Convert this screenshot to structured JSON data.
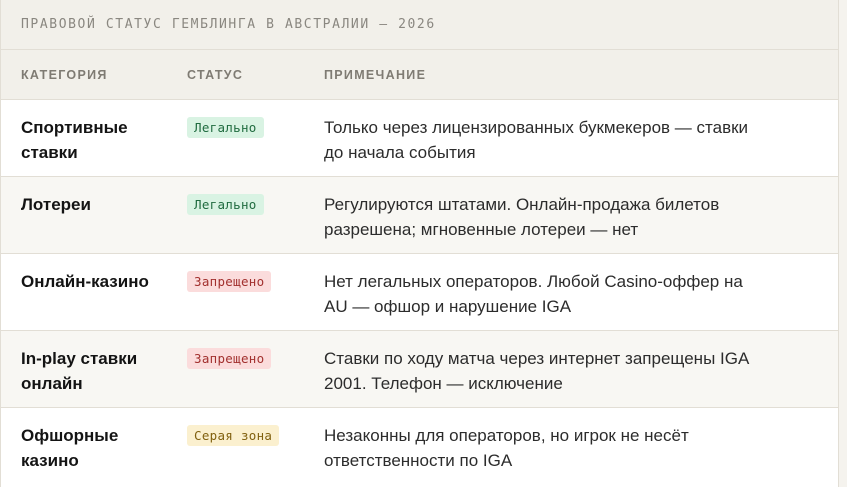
{
  "title": "ПРАВОВОЙ СТАТУС ГЕМБЛИНГА В АВСТРАЛИИ — 2026",
  "columns": {
    "category": "КАТЕГОРИЯ",
    "status": "СТАТУС",
    "note": "ПРИМЕЧАНИЕ"
  },
  "rows": [
    {
      "category_l1": "Спортивные",
      "category_l2": "ставки",
      "status": "Легально",
      "status_color": "#d9f3e3",
      "note_l1": "Только через лицензированных букмекеров — ставки",
      "note_l2": "до начала события"
    },
    {
      "category_l1": "Лотереи",
      "category_l2": "",
      "status": "Легально",
      "status_color": "#d9f3e3",
      "note_l1": "Регулируются штатами. Онлайн-продажа билетов",
      "note_l2": "разрешена; мгновенные лотереи — нет"
    },
    {
      "category_l1": "Онлайн-казино",
      "category_l2": "",
      "status": "Запрещено",
      "status_color": "#fbdcdc",
      "note_l1": "Нет легальных операторов. Любой Casino-оффер на",
      "note_l2": "AU — офшор и нарушение IGA"
    },
    {
      "category_l1": "In-play ставки",
      "category_l2": "онлайн",
      "status": "Запрещено",
      "status_color": "#fbdcdc",
      "note_l1": "Ставки по ходу матча через интернет запрещены IGA",
      "note_l2": "2001. Телефон — исключение"
    },
    {
      "category_l1": "Офшорные",
      "category_l2": "казино",
      "status": "Серая зона",
      "status_color": "#fbf0cf",
      "note_l1": "Незаконны для операторов, но игрок не несёт",
      "note_l2": "ответственности по IGA"
    }
  ]
}
